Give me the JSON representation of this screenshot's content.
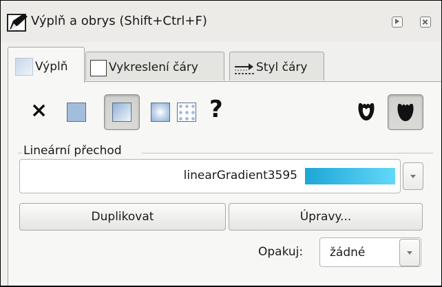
{
  "window": {
    "title": "Výplň a obrys (Shift+Ctrl+F)"
  },
  "tabs": [
    {
      "label": "Výplň",
      "active": true
    },
    {
      "label": "Vykreslení čáry",
      "active": false
    },
    {
      "label": "Styl čáry",
      "active": false
    }
  ],
  "paint_types": [
    {
      "name": "none",
      "glyph": "×"
    },
    {
      "name": "flat-color"
    },
    {
      "name": "linear-gradient",
      "selected": true
    },
    {
      "name": "radial-gradient"
    },
    {
      "name": "pattern"
    },
    {
      "name": "unset",
      "glyph": "?"
    }
  ],
  "fill_rules": [
    {
      "name": "evenodd"
    },
    {
      "name": "nonzero",
      "selected": true
    }
  ],
  "gradient": {
    "section_label": "Lineární přechod",
    "name": "linearGradient3595",
    "color_start": "#1da6d6",
    "color_end": "#63d8f8"
  },
  "buttons": {
    "duplicate": "Duplikovat",
    "edit": "Úpravy..."
  },
  "repeat": {
    "label": "Opakuj:",
    "value": "žádné"
  }
}
